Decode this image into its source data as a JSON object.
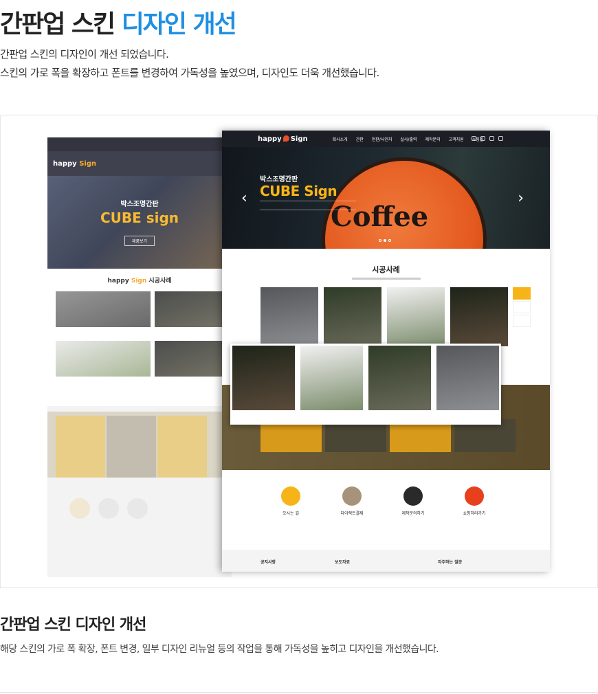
{
  "header": {
    "title_part1": "간판업 스킨",
    "title_part2": "디자인 개선",
    "accent_color": "#1e8fe3",
    "intro_line1": "간판업 스킨의 디자인이 개선 되었습니다.",
    "intro_line2": "스킨의 가로 폭을 확장하고 폰트를 변경하여 가독성을 높였으며, 디자인도 더욱 개선했습니다."
  },
  "old_mockup": {
    "logo": "happy",
    "logo_suffix": "Sign",
    "hero_sub": "박스조명간판",
    "hero_title": "CUBE sign",
    "hero_btn": "제품보기",
    "section_title_prefix": "happy",
    "section_title_brand": "Sign",
    "section_title_suffix": "시공사례"
  },
  "new_mockup": {
    "logo": "happy",
    "logo_suffix": "Sign",
    "menu": [
      "회사소개",
      "간판",
      "현판/사인지",
      "실사/출력",
      "제작문의",
      "고객지원",
      "쇼핑몰"
    ],
    "hero_sub": "박스조명간판",
    "hero_title": "CUBE Sign",
    "hero_sign_word": "Coffee",
    "cases_title": "시공사례",
    "info_items": [
      "오시는 길",
      "다이렉트결제",
      "제작문의하기",
      "쇼핑하러가기"
    ],
    "footer_items": [
      "공지사항",
      "보도자료",
      "자주하는 질문"
    ]
  },
  "section2": {
    "title": "간판업 스킨 디자인 개선",
    "description": "해당 스킨의 가로 폭 확장, 폰트 변경, 일부 디자인 리뉴얼 등의 작업을 통해 가독성을 높히고 디자인을 개선했습니다."
  }
}
